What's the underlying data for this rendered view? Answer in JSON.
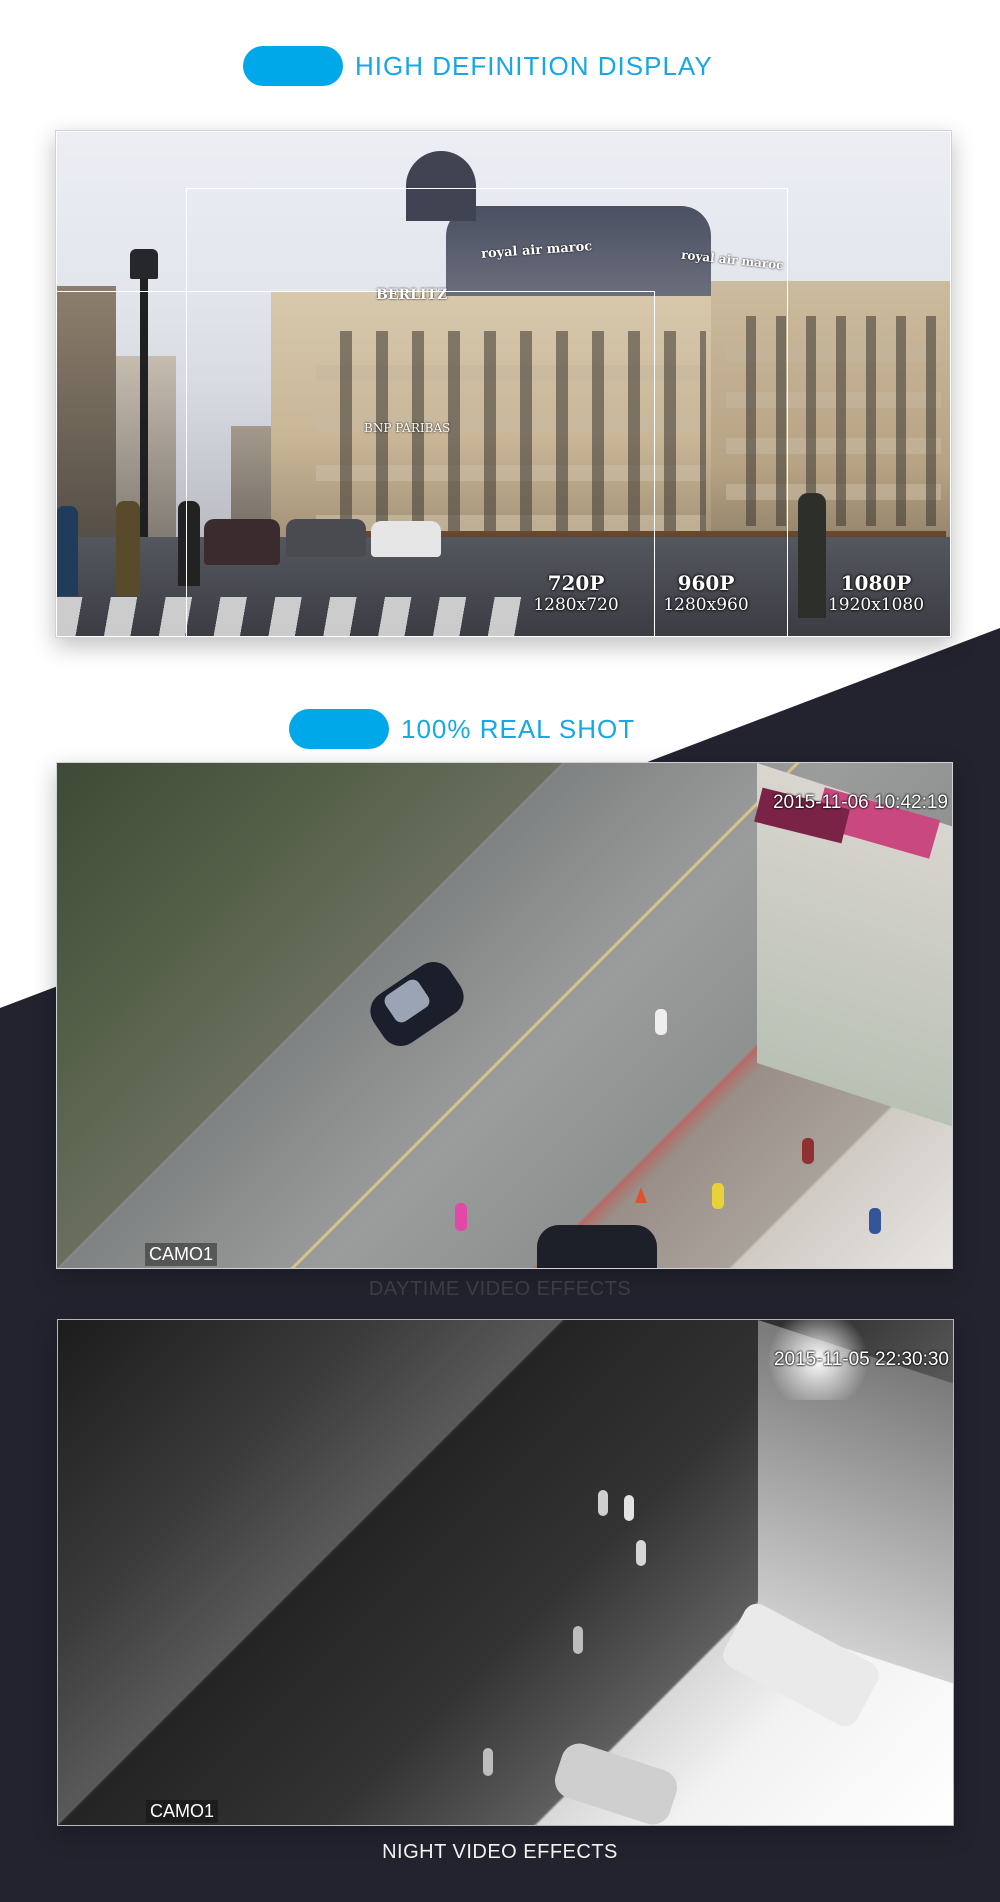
{
  "sections": {
    "hd": {
      "heading": "HIGH DEFINITION DISPLAY",
      "image": {
        "sign_berlitz": "BERLITZ",
        "sign_bnp": "BNP PARIBAS",
        "sign_royal": "royal air maroc",
        "resolutions": [
          {
            "label": "720P",
            "dims": "1280x720"
          },
          {
            "label": "960P",
            "dims": "1280x960"
          },
          {
            "label": "1080P",
            "dims": "1920x1080"
          }
        ]
      }
    },
    "real_shot": {
      "heading": "100% REAL SHOT",
      "day": {
        "timestamp": "2015-11-06 10:42:19",
        "camera": "CAMO1",
        "caption": "DAYTIME VIDEO EFFECTS"
      },
      "night": {
        "timestamp": "2015-11-05 22:30:30",
        "camera": "CAMO1",
        "caption": "NIGHT VIDEO EFFECTS"
      }
    }
  },
  "colors": {
    "accent": "#00a8ea",
    "heading_text": "#17a8e3",
    "dark_background": "#23232f"
  }
}
